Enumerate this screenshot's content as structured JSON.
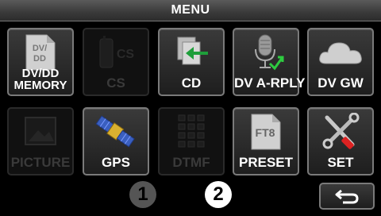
{
  "title": "MENU",
  "tiles": [
    {
      "label_line1": "DV/DD",
      "label_line2": "MEMORY",
      "icon_text": "DV/\nDD",
      "icon": "document-icon",
      "enabled": true
    },
    {
      "label": "CS",
      "icon_text": "CS",
      "icon": "radio-handset-icon",
      "enabled": false
    },
    {
      "label": "CD",
      "icon": "call-record-icon",
      "enabled": true
    },
    {
      "label": "DV A-RPLY",
      "icon": "microphone-reply-icon",
      "enabled": true
    },
    {
      "label": "DV GW",
      "icon": "cloud-icon",
      "enabled": true
    },
    {
      "label": "PICTURE",
      "icon": "picture-icon",
      "enabled": false
    },
    {
      "label": "GPS",
      "icon": "satellite-icon",
      "enabled": true
    },
    {
      "label": "DTMF",
      "icon": "keypad-icon",
      "enabled": false
    },
    {
      "label": "PRESET",
      "icon_text": "FT8",
      "icon": "preset-document-icon",
      "enabled": true
    },
    {
      "label": "SET",
      "icon": "tools-icon",
      "enabled": true
    }
  ],
  "pages": [
    {
      "number": "1",
      "active": false
    },
    {
      "number": "2",
      "active": true
    }
  ],
  "back_icon": "return-arrow-icon",
  "colors": {
    "arrow_green": "#1e9e3a",
    "accent_green": "#2ecc40"
  }
}
